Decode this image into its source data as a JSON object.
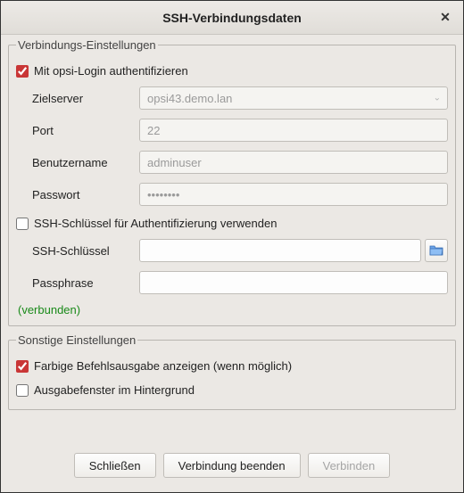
{
  "window": {
    "title": "SSH-Verbindungsdaten"
  },
  "connection": {
    "legend": "Verbindungs-Einstellungen",
    "opsi_login_label": "Mit opsi-Login authentifizieren",
    "opsi_login_checked": true,
    "target_server_label": "Zielserver",
    "target_server_value": "opsi43.demo.lan",
    "port_label": "Port",
    "port_value": "22",
    "username_label": "Benutzername",
    "username_value": "adminuser",
    "password_label": "Passwort",
    "password_value": "••••••••",
    "use_sshkey_label": "SSH-Schlüssel für Authentifizierung verwenden",
    "use_sshkey_checked": false,
    "sshkey_label": "SSH-Schlüssel",
    "sshkey_value": "",
    "passphrase_label": "Passphrase",
    "passphrase_value": "",
    "status": "(verbunden)"
  },
  "other": {
    "legend": "Sonstige Einstellungen",
    "colored_output_label": "Farbige Befehlsausgabe anzeigen (wenn möglich)",
    "colored_output_checked": true,
    "background_output_label": "Ausgabefenster im Hintergrund",
    "background_output_checked": false
  },
  "buttons": {
    "close": "Schließen",
    "disconnect": "Verbindung beenden",
    "connect": "Verbinden"
  }
}
